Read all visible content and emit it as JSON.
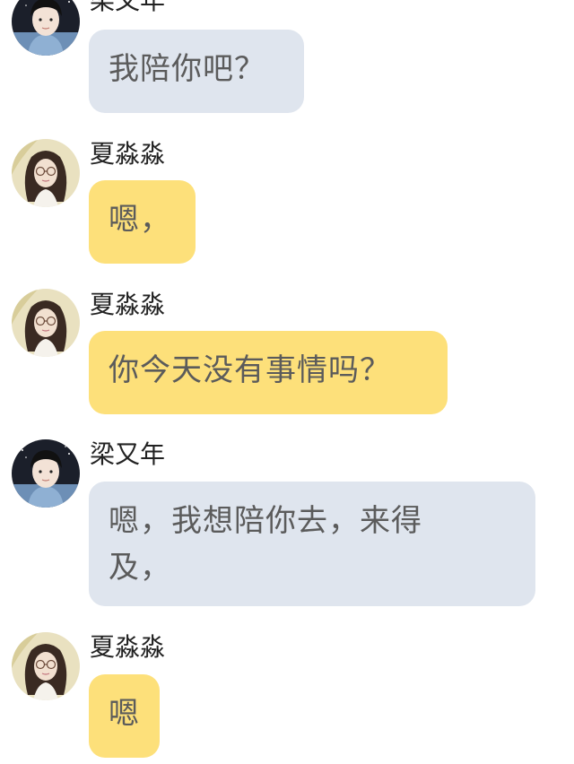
{
  "messages": [
    {
      "sender": "梁又年",
      "text": "我陪你吧？",
      "style": "blue",
      "avatar": "male-avatar"
    },
    {
      "sender": "夏淼淼",
      "text": "嗯，",
      "style": "yellow",
      "avatar": "female-avatar"
    },
    {
      "sender": "夏淼淼",
      "text": "你今天没有事情吗？",
      "style": "yellow",
      "avatar": "female-avatar"
    },
    {
      "sender": "梁又年",
      "text": "嗯，我想陪你去，来得及，",
      "style": "blue",
      "avatar": "male-avatar"
    },
    {
      "sender": "夏淼淼",
      "text": "嗯",
      "style": "yellow",
      "avatar": "female-avatar"
    }
  ],
  "colors": {
    "bubble_blue": "#dfe5ee",
    "bubble_yellow": "#fde07a",
    "text": "#5b5b5b"
  }
}
